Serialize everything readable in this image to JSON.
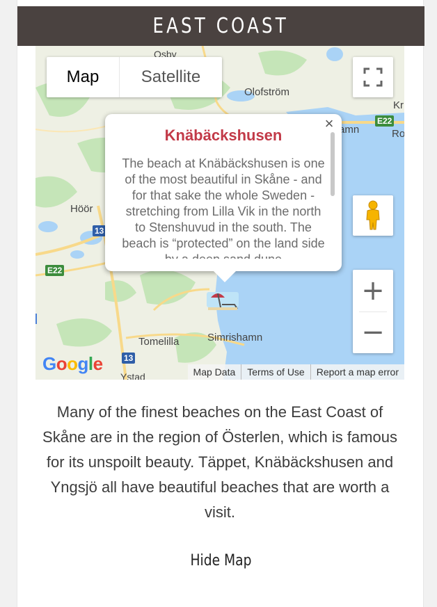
{
  "header": {
    "title": "EAST COAST"
  },
  "map": {
    "type_control": {
      "map_label": "Map",
      "satellite_label": "Satellite",
      "selected": "Map"
    },
    "place_labels": [
      "Olofström",
      "Höör",
      "Tomelilla",
      "Simrishamn",
      "Kr",
      "Ro",
      "amn",
      "Ystad",
      "Osby"
    ],
    "road_badges": [
      "E22",
      "E22",
      "13",
      "13"
    ],
    "popup": {
      "title": "Knäbäckshusen",
      "text": "The beach at Knäbäckshusen is one of the most beautiful in Skåne - and for that sake the whole Sweden - stretching from Lilla Vik in the north to Stenshuvud in the south. The beach is “protected” on the land side by a deep sand dune",
      "close_glyph": "×"
    },
    "marker_icon": "beach-umbrella-icon",
    "zoom_in_glyph": "+",
    "zoom_out_glyph": "−",
    "google_logo": "Google",
    "attribution": {
      "map_data": "Map Data",
      "terms": "Terms of Use",
      "report": "Report a map error"
    },
    "colors": {
      "water": "#aad3f6",
      "land": "#eef0e4",
      "forest": "#c5e5b8",
      "road": "#f8d98a",
      "popup_title": "#c23a48"
    }
  },
  "description": "Many of the finest beaches on the East Coast of Skåne are in the region of Österlen, which is famous for its unspoilt beauty. Täppet, Knäbäckshusen and Yngsjö all have beautiful beaches that are worth a visit.",
  "hide_map_label": "Hide Map"
}
